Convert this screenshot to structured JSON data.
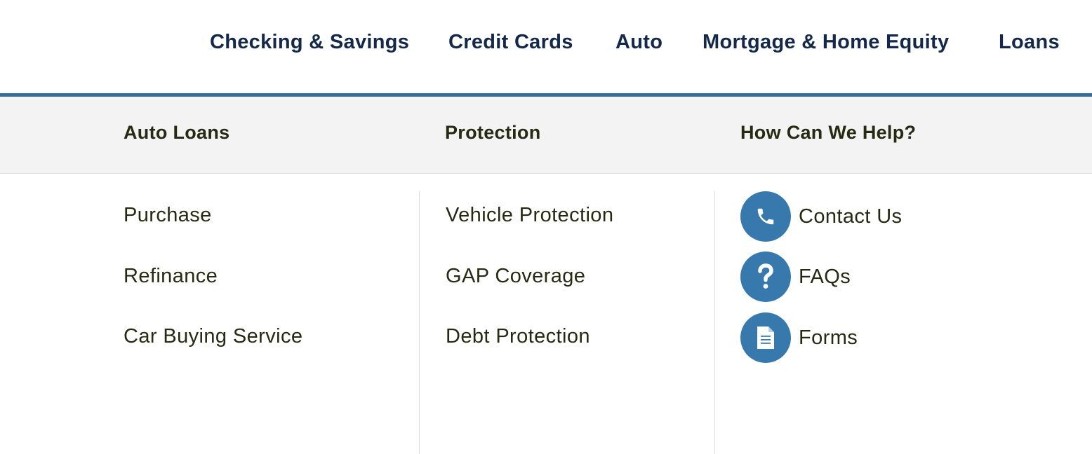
{
  "top_nav": {
    "items": [
      "Checking & Savings",
      "Credit Cards",
      "Auto",
      "Mortgage & Home Equity",
      "Loans"
    ]
  },
  "mega_menu": {
    "columns": [
      {
        "heading": "Auto Loans",
        "links": [
          "Purchase",
          "Refinance",
          "Car Buying Service"
        ]
      },
      {
        "heading": "Protection",
        "links": [
          "Vehicle Protection",
          "GAP Coverage",
          "Debt Protection"
        ]
      },
      {
        "heading": "How Can We Help?",
        "links": [
          {
            "label": "Contact Us",
            "icon": "phone-icon"
          },
          {
            "label": "FAQs",
            "icon": "question-icon"
          },
          {
            "label": "Forms",
            "icon": "document-icon"
          }
        ]
      }
    ]
  },
  "colors": {
    "nav_text": "#13284a",
    "accent": "#356c99",
    "icon_circle": "#3779ad",
    "body_text": "#272a12",
    "header_band": "#f3f3f3"
  }
}
